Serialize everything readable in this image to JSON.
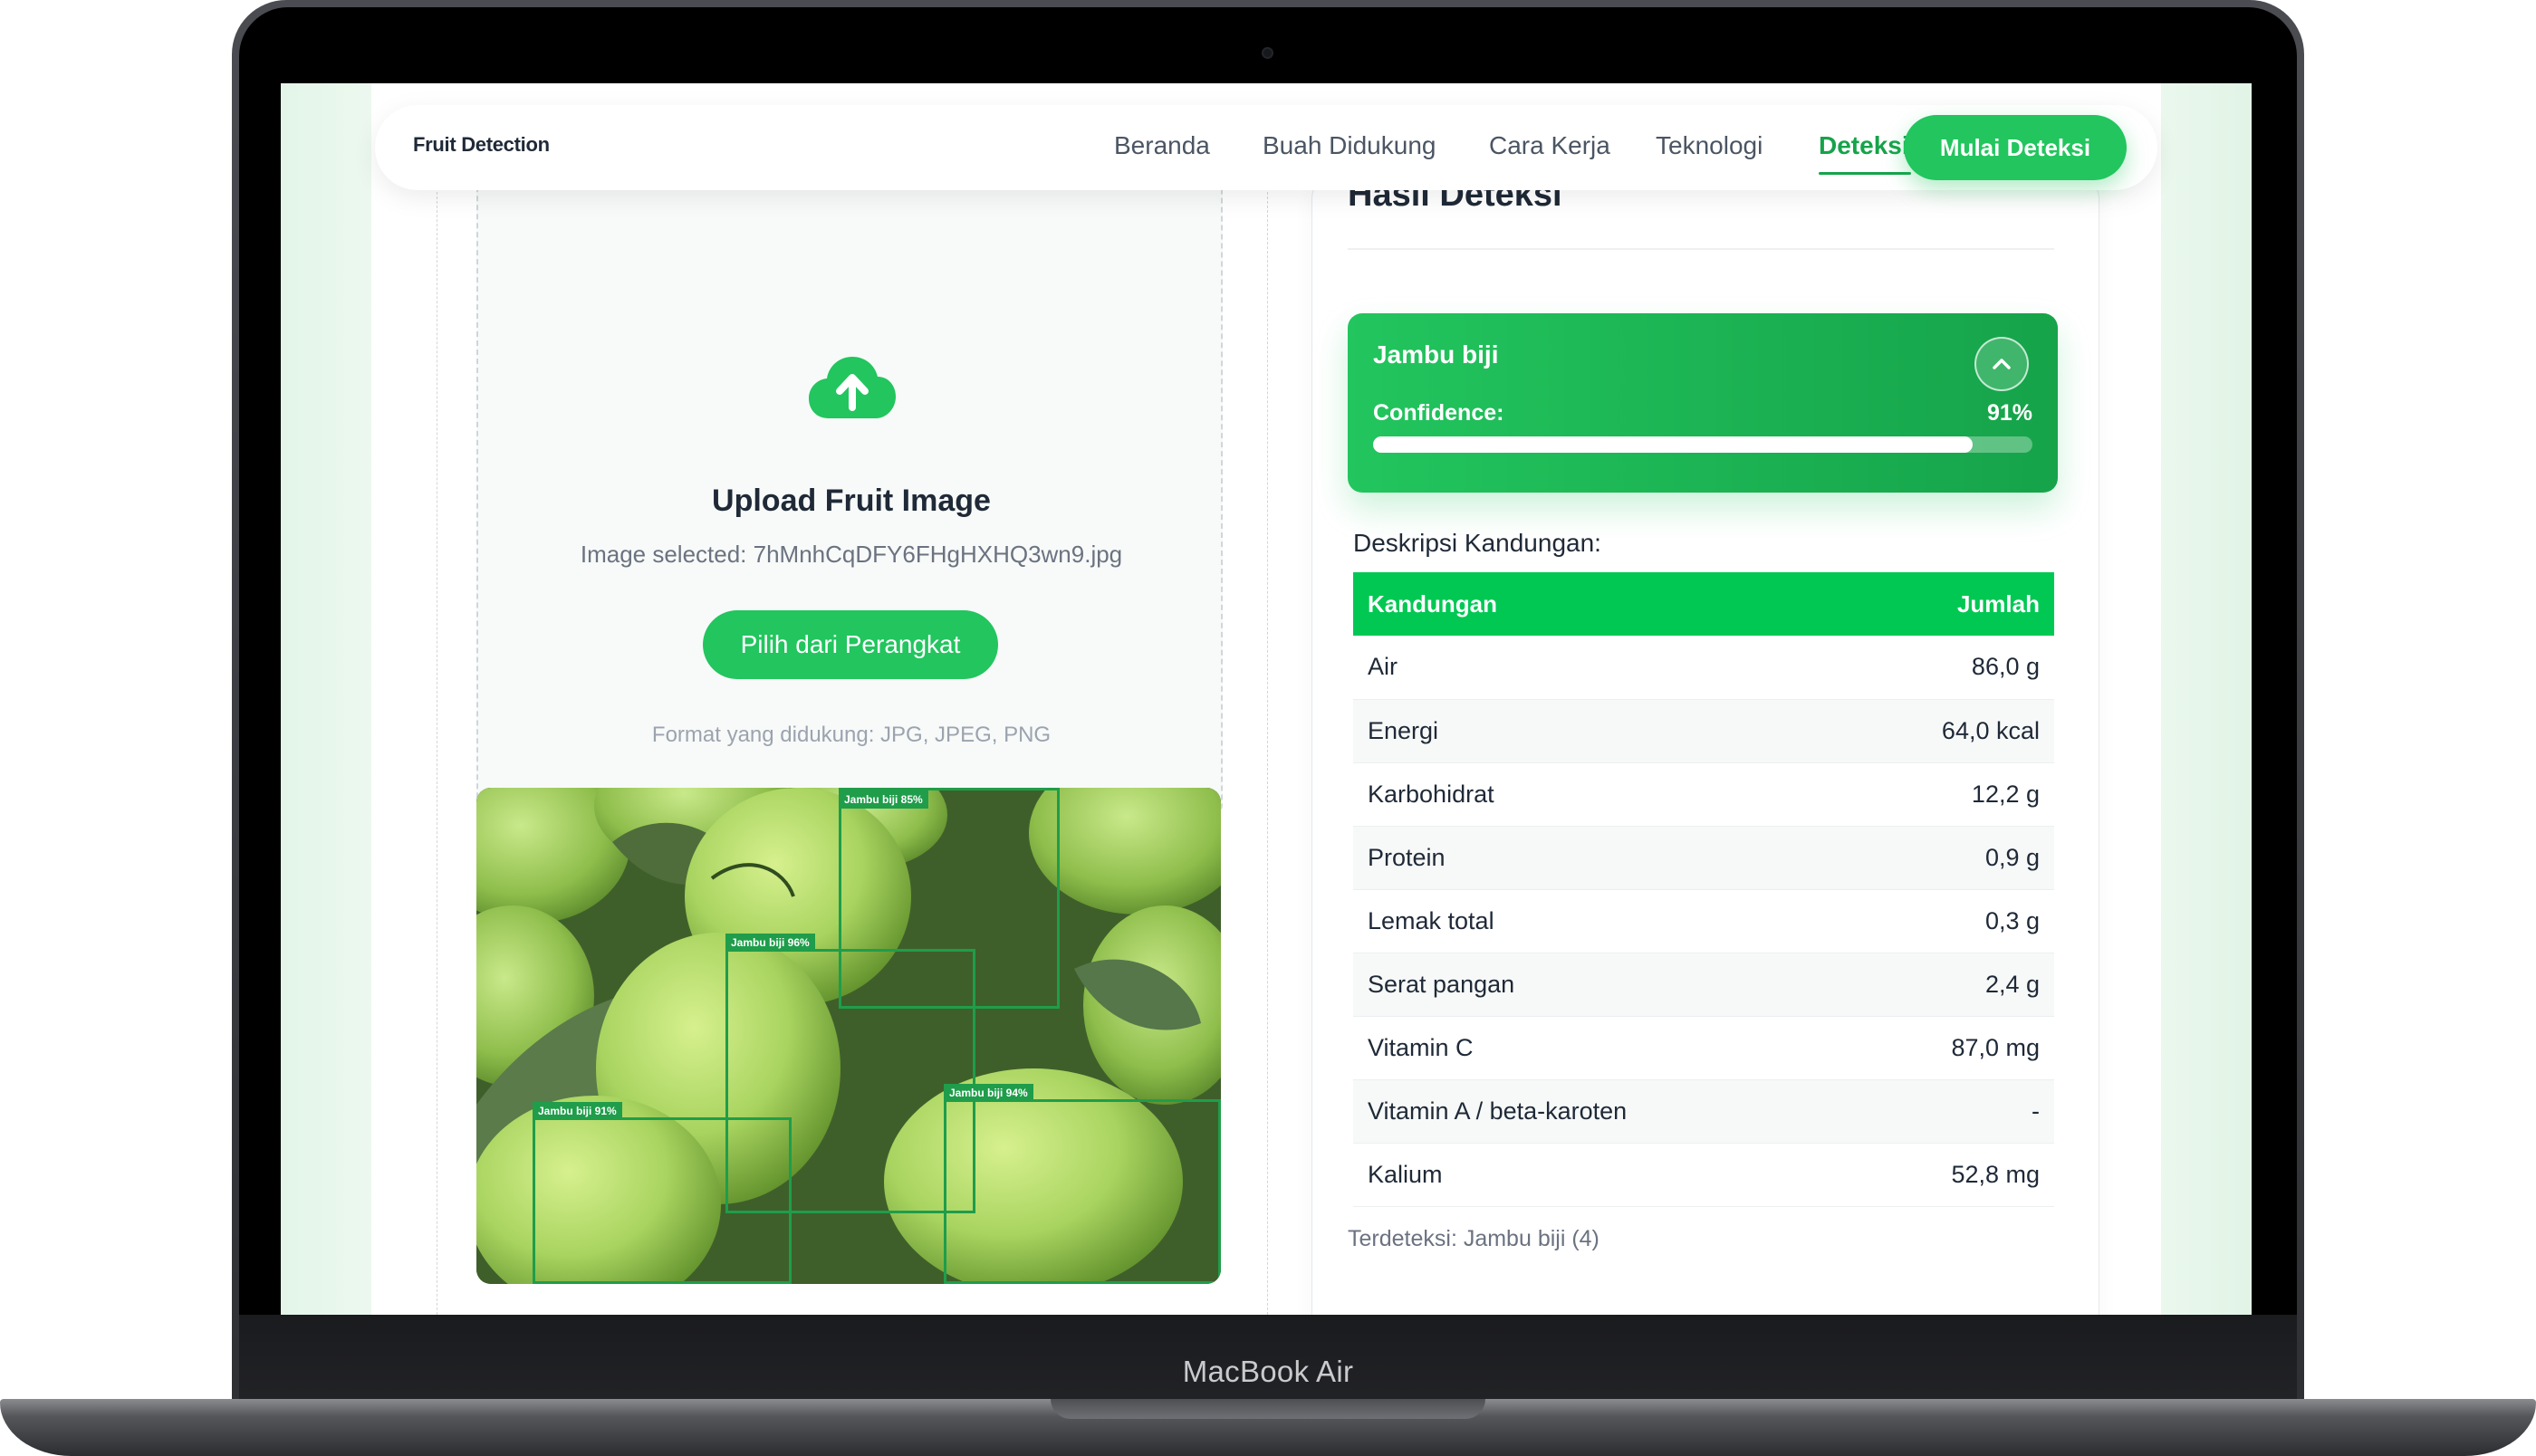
{
  "device": {
    "label": "MacBook Air"
  },
  "nav": {
    "logo": "Fruit Detection",
    "items": [
      {
        "label": "Beranda"
      },
      {
        "label": "Buah Didukung"
      },
      {
        "label": "Cara Kerja"
      },
      {
        "label": "Teknologi"
      },
      {
        "label": "Deteksi"
      }
    ],
    "active": "Deteksi",
    "cta": "Mulai Deteksi"
  },
  "upload": {
    "title": "Upload Fruit Image",
    "selected": "Image selected: 7hMnhCqDFY6FHgHXHQ3wn9.jpg",
    "button": "Pilih dari Perangkat",
    "formats": "Format yang didukung: JPG, JPEG, PNG",
    "icon": "cloud-upload-icon"
  },
  "detections": [
    {
      "label": "Jambu biji 85%"
    },
    {
      "label": "Jambu biji 96%"
    },
    {
      "label": "Jambu biji 94%"
    },
    {
      "label": "Jambu biji 91%"
    }
  ],
  "result": {
    "title": "Hasil Deteksi",
    "fruit": "Jambu biji",
    "confidence_label": "Confidence:",
    "confidence_text": "91%",
    "confidence": 0.91,
    "toggle_icon": "chevron-up-icon",
    "desc_label": "Deskripsi Kandungan:",
    "table": {
      "headers": [
        "Kandungan",
        "Jumlah"
      ],
      "rows": [
        [
          "Air",
          "86,0 g"
        ],
        [
          "Energi",
          "64,0 kcal"
        ],
        [
          "Karbohidrat",
          "12,2 g"
        ],
        [
          "Protein",
          "0,9 g"
        ],
        [
          "Lemak total",
          "0,3 g"
        ],
        [
          "Serat pangan",
          "2,4 g"
        ],
        [
          "Vitamin C",
          "87,0 mg"
        ],
        [
          "Vitamin A / beta-karoten",
          "-"
        ],
        [
          "Kalium",
          "52,8 mg"
        ]
      ]
    },
    "detected": "Terdeteksi: Jambu biji (4)"
  },
  "colors": {
    "accent": "#22c55e",
    "accent_dark": "#16a34a",
    "table_header": "#00c853"
  }
}
